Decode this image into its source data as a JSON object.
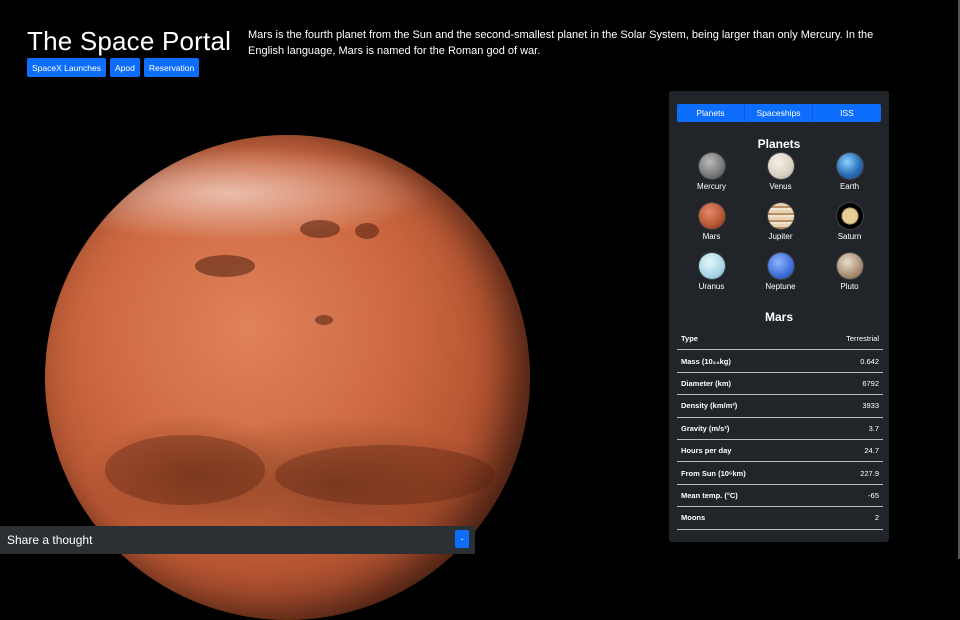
{
  "header": {
    "title": "The Space Portal",
    "nav": [
      {
        "label": "SpaceX Launches"
      },
      {
        "label": "Apod"
      },
      {
        "label": "Reservation"
      }
    ]
  },
  "intro": "Mars is the fourth planet from the Sun and the second-smallest planet in the Solar System, being larger than only Mercury. In the English language, Mars is named for the Roman god of war.",
  "share": {
    "label": "Share a thought",
    "button": "-"
  },
  "panel": {
    "tabs": [
      {
        "label": "Planets"
      },
      {
        "label": "Spaceships"
      },
      {
        "label": "ISS"
      }
    ],
    "planets_heading": "Planets",
    "planets": [
      {
        "name": "Mercury"
      },
      {
        "name": "Venus"
      },
      {
        "name": "Earth"
      },
      {
        "name": "Mars"
      },
      {
        "name": "Jupiter"
      },
      {
        "name": "Saturn"
      },
      {
        "name": "Uranus"
      },
      {
        "name": "Neptune"
      },
      {
        "name": "Pluto"
      }
    ],
    "selected_heading": "Mars",
    "facts": [
      {
        "label": "Type",
        "value": "Terrestrial"
      },
      {
        "label": "Mass (10₂₄kg)",
        "value": "0.642"
      },
      {
        "label": "Diameter (km)",
        "value": "6792"
      },
      {
        "label": "Density (km/m³)",
        "value": "3933"
      },
      {
        "label": "Gravity (m/s²)",
        "value": "3.7"
      },
      {
        "label": "Hours per day",
        "value": "24.7"
      },
      {
        "label": "From Sun (10⁶km)",
        "value": "227.9"
      },
      {
        "label": "Mean temp. (°C)",
        "value": "-65"
      },
      {
        "label": "Moons",
        "value": "2"
      }
    ]
  },
  "colors": {
    "accent": "#0d6efd",
    "panel_bg": "#212529",
    "page_bg": "#000000"
  }
}
